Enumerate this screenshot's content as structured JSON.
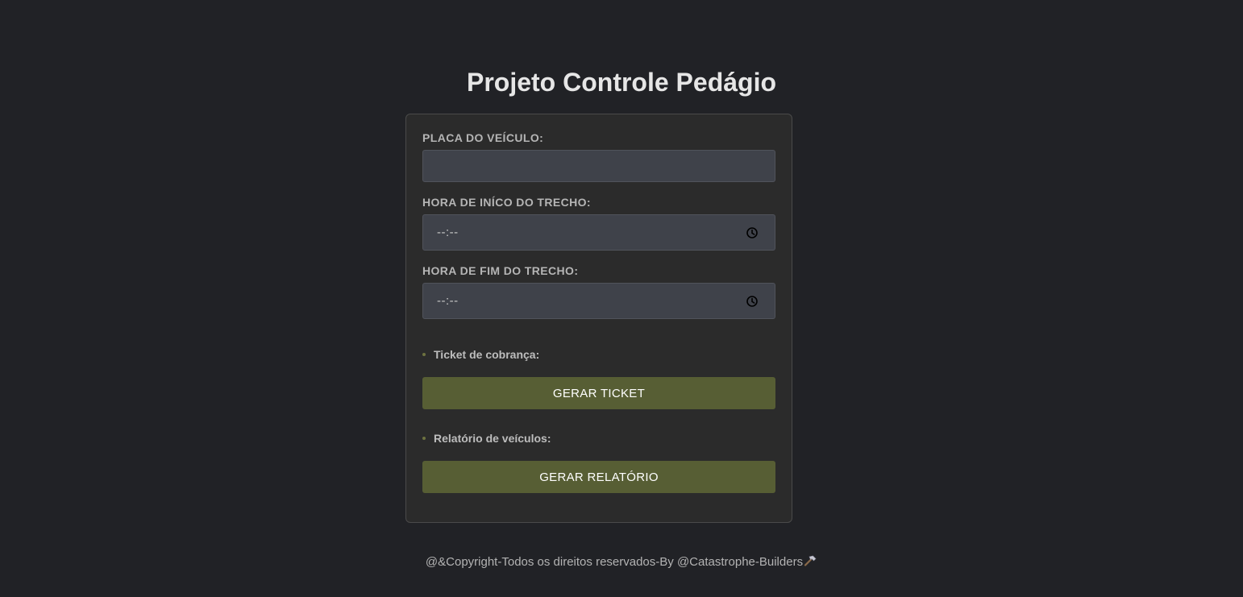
{
  "page": {
    "title": "Projeto Controle Pedágio"
  },
  "form": {
    "plate": {
      "label": "PLACA DO VEÍCULO:",
      "value": ""
    },
    "start_time": {
      "label": "HORA DE INÍCO DO TRECHO:",
      "value": "--:--",
      "icon": "clock-icon"
    },
    "end_time": {
      "label": "HORA DE FIM DO TRECHO:",
      "value": "--:--",
      "icon": "clock-icon"
    }
  },
  "ticket": {
    "label": "Ticket de cobrança:",
    "button_label": "GERAR TICKET"
  },
  "report": {
    "label": "Relatório de veículos:",
    "button_label": "GERAR RELATÓRIO"
  },
  "footer": {
    "text": "@&Copyright-Todos os direitos reservados-By @Catastrophe-Builders",
    "icon": "hammer-icon"
  },
  "colors": {
    "background": "#212226",
    "card": "#2b2b2b",
    "input": "#3f424a",
    "button": "#575e34",
    "bullet": "#6d7240"
  }
}
